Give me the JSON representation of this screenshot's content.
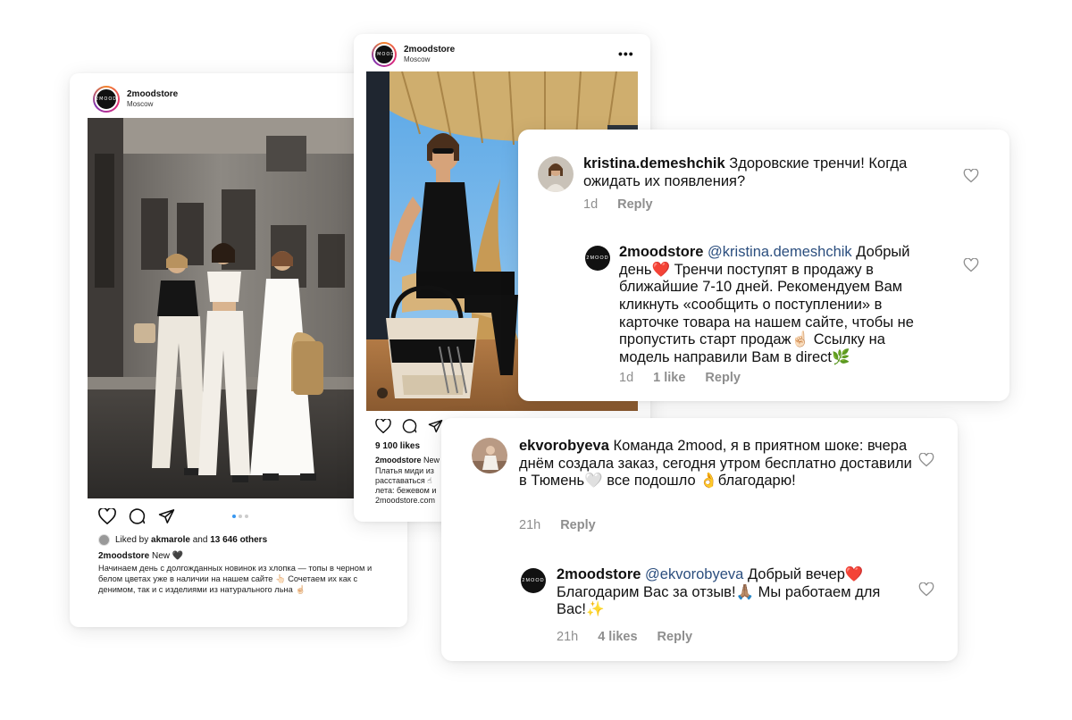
{
  "post1": {
    "username": "2moodstore",
    "location": "Moscow",
    "avatar_text": "2MOOD",
    "icons": [
      "heart-icon",
      "comment-icon",
      "share-icon"
    ],
    "carousel": {
      "count": 3,
      "active": 1
    },
    "liked_prefix": "Liked by",
    "liked_user": "akmarole",
    "liked_and": "and",
    "liked_count": "13 646 others",
    "caption_user": "2moodstore",
    "caption_title": "New 🖤",
    "caption_text": "Начинаем день с долгожданных новинок из хлопка — топы в черном и белом цветах уже в наличии на нашем сайте 👆🏻 Сочетаем их как с денимом, так и с изделиями из натурального льна ☝🏻"
  },
  "post2": {
    "username": "2moodstore",
    "location": "Moscow",
    "avatar_text": "2MOOD",
    "more": "•••",
    "likes": "9 100 likes",
    "caption_user": "2moodstore",
    "caption_first": "New",
    "caption_lines": [
      "Платья миди из",
      "расставаться ☝",
      "лета: бежевом и",
      "2moodstore.com"
    ]
  },
  "comment_card_1": {
    "comment": {
      "user": "kristina.demeshchik",
      "text": "Здоровские тренчи! Когда ожидать их появления?",
      "time": "1d",
      "reply": "Reply"
    },
    "reply": {
      "user": "2moodstore",
      "mention": "@kristina.demeshchik",
      "text": "Добрый день❤️ Тренчи поступят в продажу в ближайшие 7-10 дней. Рекомендуем Вам кликнуть «сообщить о поступлении» в карточке товара на нашем сайте, чтобы не пропустить старт продаж☝🏻 Ссылку на модель направили Вам в direct🌿",
      "time": "1d",
      "likes": "1 like",
      "reply": "Reply",
      "avatar_text": "2MOOD"
    }
  },
  "comment_card_2": {
    "comment": {
      "user": "ekvorobyeva",
      "text": "Команда 2mood, я в приятном шоке: вчера днём создала заказ, сегодня утром бесплатно доставили в Тюмень🤍 все подошло 👌благодарю!",
      "time": "21h",
      "reply": "Reply"
    },
    "reply": {
      "user": "2moodstore",
      "mention": "@ekvorobyeva",
      "text": "Добрый вечер❤️ Благодарим Вас за отзыв!🙏🏽 Мы работаем для Вас!✨",
      "time": "21h",
      "likes": "4 likes",
      "reply": "Reply",
      "avatar_text": "2MOOD"
    }
  },
  "colors": {
    "mention": "#2b4e7e",
    "meta": "#8e8e8e",
    "carousel_active": "#3897f0"
  }
}
